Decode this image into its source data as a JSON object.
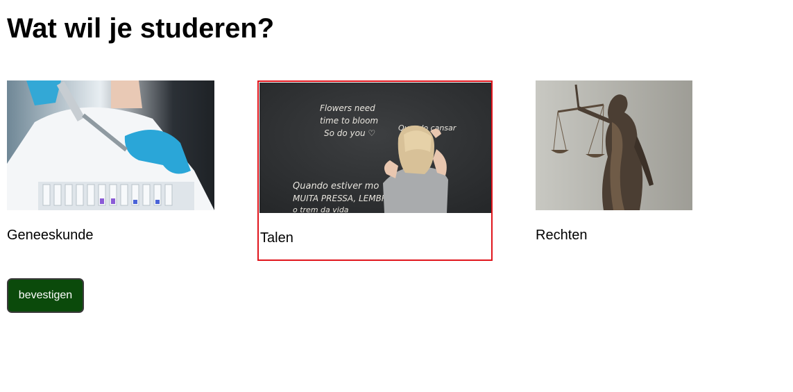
{
  "page": {
    "title": "Wat wil je studeren?"
  },
  "options": [
    {
      "label": "Geneeskunde",
      "image": "lab-pipette-photo",
      "selected": false
    },
    {
      "label": "Talen",
      "image": "chalkboard-writing-photo",
      "selected": true
    },
    {
      "label": "Rechten",
      "image": "lady-justice-statue-photo",
      "selected": false
    }
  ],
  "chalkboard": {
    "line1": "Flowers need",
    "line2": "time to bloom",
    "line3": "So do you ♡",
    "line4": "Quando cansar",
    "line5": "Quando estiver mo",
    "line6": "MUITA PRESSA, LEMBR",
    "line7": "o trem da vida"
  },
  "confirm_button": {
    "label": "bevestigen"
  },
  "colors": {
    "selected_border": "#e0141b",
    "button_bg": "#0b4a0b",
    "button_text": "#ffffff"
  }
}
